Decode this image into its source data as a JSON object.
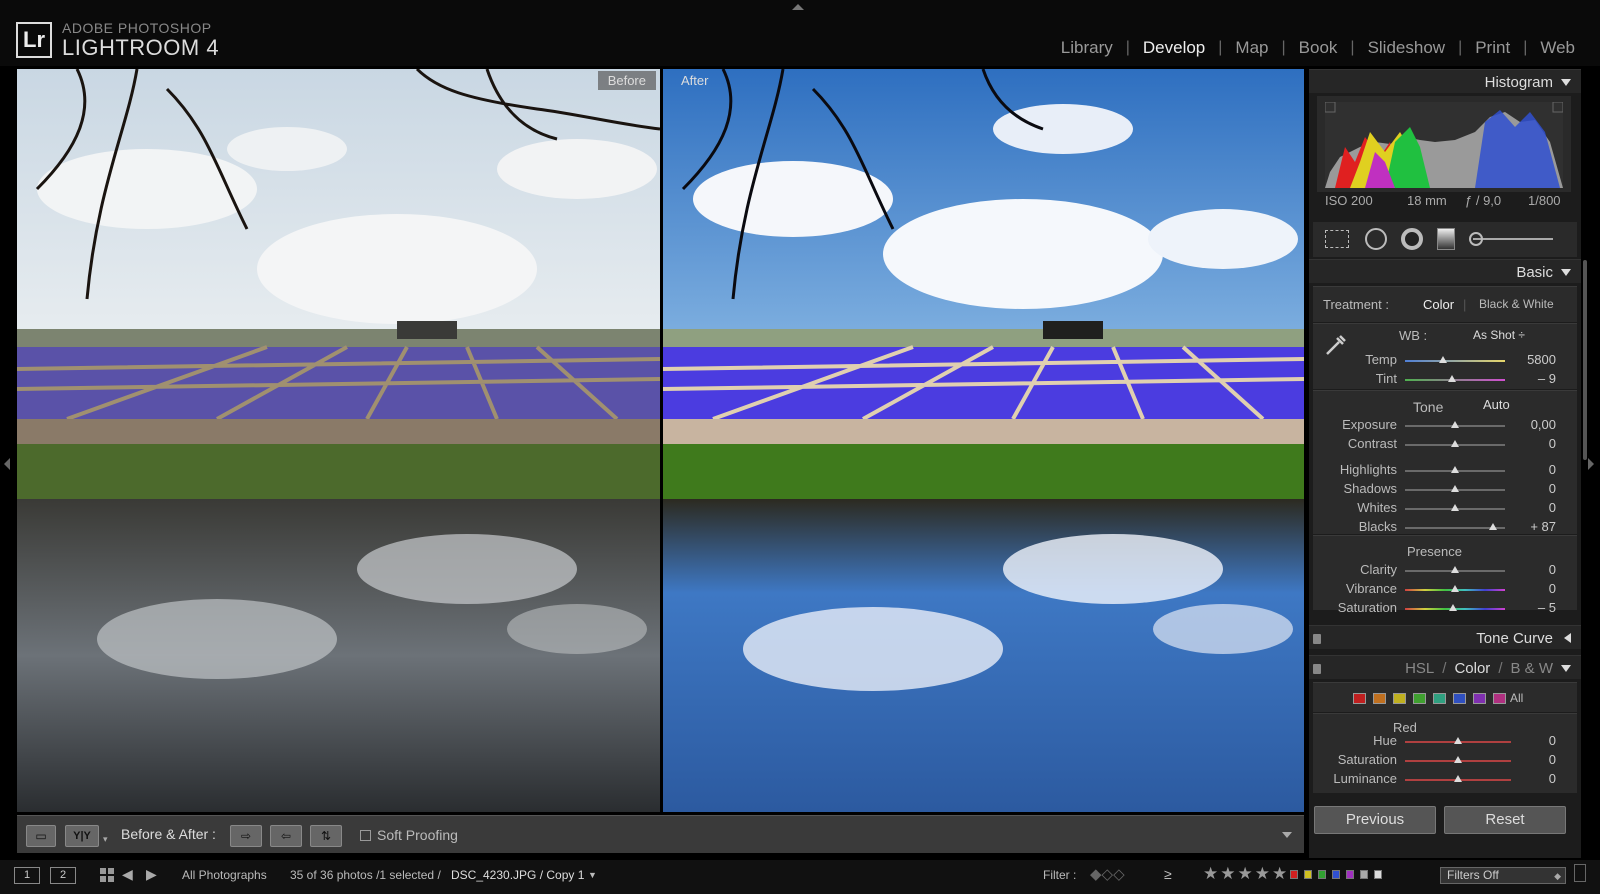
{
  "app": {
    "logo": "Lr",
    "brand_small": "ADOBE PHOTOSHOP",
    "brand_big": "LIGHTROOM 4"
  },
  "modules": [
    {
      "label": "Library",
      "active": false
    },
    {
      "label": "Develop",
      "active": true
    },
    {
      "label": "Map",
      "active": false
    },
    {
      "label": "Book",
      "active": false
    },
    {
      "label": "Slideshow",
      "active": false
    },
    {
      "label": "Print",
      "active": false
    },
    {
      "label": "Web",
      "active": false
    }
  ],
  "viewer": {
    "before_label": "Before",
    "after_label": "After"
  },
  "toolbar": {
    "yy_label": "Y|Y",
    "before_after_label": "Before & After :",
    "soft_proofing_label": "Soft Proofing",
    "soft_proofing_checked": false
  },
  "filmstrip": {
    "page1": "1",
    "page2": "2",
    "source": "All Photographs",
    "count_text": "35 of 36 photos /1 selected /",
    "filename": "DSC_4230.JPG / Copy 1",
    "filter_label": "Filter :",
    "rating_op": "≥",
    "stars": "★★★★★",
    "color_labels": [
      "#d02020",
      "#d0c020",
      "#30a030",
      "#3050d0",
      "#a030c0",
      "#aaaaaa",
      "#dddddd"
    ],
    "filters_off": "Filters Off"
  },
  "panel": {
    "histogram": {
      "title": "Histogram",
      "iso": "ISO 200",
      "focal": "18 mm",
      "aperture": "ƒ / 9,0",
      "shutter": "1/800"
    },
    "basic": {
      "title": "Basic",
      "treatment_label": "Treatment :",
      "treatment_color": "Color",
      "treatment_bw": "Black & White",
      "wb_label": "WB :",
      "wb_value": "As Shot ÷",
      "tone_label": "Tone",
      "auto_label": "Auto",
      "presence_label": "Presence"
    },
    "sliders": [
      {
        "label": "Temp",
        "value": "5800",
        "pos": 0.38,
        "track": "temp"
      },
      {
        "label": "Tint",
        "value": "– 9",
        "pos": 0.47,
        "track": "tint"
      },
      {
        "label": "Exposure",
        "value": "0,00",
        "pos": 0.5,
        "track": "grey"
      },
      {
        "label": "Contrast",
        "value": "0",
        "pos": 0.5,
        "track": "grey"
      },
      {
        "label": "Highlights",
        "value": "0",
        "pos": 0.5,
        "track": "grey"
      },
      {
        "label": "Shadows",
        "value": "0",
        "pos": 0.5,
        "track": "grey"
      },
      {
        "label": "Whites",
        "value": "0",
        "pos": 0.5,
        "track": "grey"
      },
      {
        "label": "Blacks",
        "value": "+ 87",
        "pos": 0.88,
        "track": "grey"
      },
      {
        "label": "Clarity",
        "value": "0",
        "pos": 0.5,
        "track": "grey"
      },
      {
        "label": "Vibrance",
        "value": "0",
        "pos": 0.5,
        "track": "rainbow"
      },
      {
        "label": "Saturation",
        "value": "– 5",
        "pos": 0.48,
        "track": "rainbow"
      }
    ],
    "tone_curve": {
      "title": "Tone Curve"
    },
    "hsl": {
      "title_hsl": "HSL",
      "title_color": "Color",
      "title_bw": "B & W",
      "sep": "/",
      "swatches": [
        "#c02020",
        "#c07020",
        "#c0b020",
        "#40a030",
        "#30a080",
        "#3050c0",
        "#8030b0",
        "#b03080"
      ],
      "all_label": "All",
      "red_label": "Red",
      "rows": [
        {
          "label": "Hue",
          "value": "0",
          "pos": 0.5
        },
        {
          "label": "Saturation",
          "value": "0",
          "pos": 0.5
        },
        {
          "label": "Luminance",
          "value": "0",
          "pos": 0.5
        }
      ]
    },
    "previous_label": "Previous",
    "reset_label": "Reset"
  }
}
